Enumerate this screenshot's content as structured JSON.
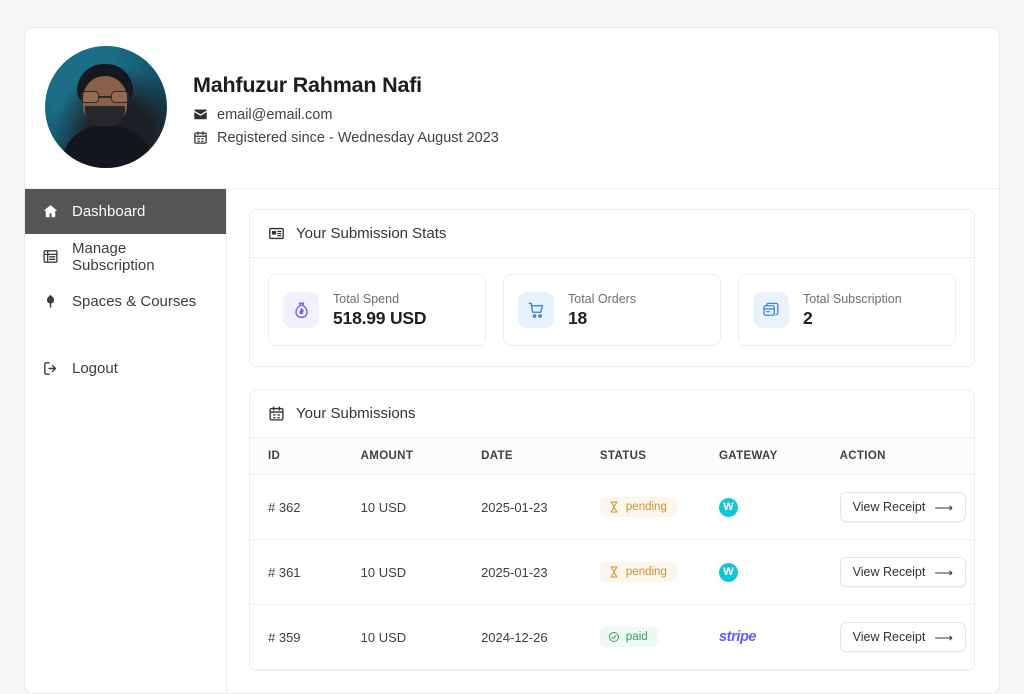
{
  "profile": {
    "name": "Mahfuzur Rahman Nafi",
    "email": "email@email.com",
    "registered": "Registered since - Wednesday August 2023",
    "avatar_alt": "user-avatar-photo"
  },
  "sidebar": {
    "items": [
      {
        "label": "Dashboard",
        "icon": "home-icon",
        "active": true
      },
      {
        "label": "Manage Subscription",
        "icon": "list-icon",
        "active": false
      },
      {
        "label": "Spaces & Courses",
        "icon": "spaces-icon",
        "active": false
      }
    ],
    "logout": {
      "label": "Logout",
      "icon": "logout-icon"
    }
  },
  "stats_panel": {
    "title": "Your Submission Stats",
    "icon": "id-card-icon",
    "cards": [
      {
        "label": "Total Spend",
        "value": "518.99 USD",
        "icon": "money-bag-icon",
        "icon_color": "#7b5cd6",
        "icon_bg": "#f2efff"
      },
      {
        "label": "Total Orders",
        "value": "18",
        "icon": "shopping-cart-icon",
        "icon_color": "#2f7fd6",
        "icon_bg": "#e8f2fd"
      },
      {
        "label": "Total Subscription",
        "value": "2",
        "icon": "subscription-card-icon",
        "icon_color": "#3b8ade",
        "icon_bg": "#eaf3fd"
      }
    ]
  },
  "submissions_panel": {
    "title": "Your Submissions",
    "icon": "calendar-icon",
    "columns": [
      "ID",
      "AMOUNT",
      "DATE",
      "STATUS",
      "GATEWAY",
      "ACTION"
    ],
    "rows": [
      {
        "id": "# 362",
        "amount": "10 USD",
        "date": "2025-01-23",
        "status": "pending",
        "status_type": "pending",
        "status_icon": "hourglass-icon",
        "gateway": "W",
        "gateway_type": "circle",
        "action": "View Receipt"
      },
      {
        "id": "# 361",
        "amount": "10 USD",
        "date": "2025-01-23",
        "status": "pending",
        "status_type": "pending",
        "status_icon": "hourglass-icon",
        "gateway": "W",
        "gateway_type": "circle",
        "action": "View Receipt"
      },
      {
        "id": "# 359",
        "amount": "10 USD",
        "date": "2024-12-26",
        "status": "paid",
        "status_type": "paid",
        "status_icon": "check-circle-icon",
        "gateway": "stripe",
        "gateway_type": "stripe",
        "action": "View Receipt"
      }
    ]
  },
  "colors": {
    "accent_purple": "#7b5cd6",
    "accent_blue": "#2f7fd6",
    "pending": "#c8922f",
    "paid": "#3f9c63",
    "stripe": "#635bff",
    "gateway_circle": "#16c4d8",
    "sidebar_active_bg": "#555555"
  }
}
